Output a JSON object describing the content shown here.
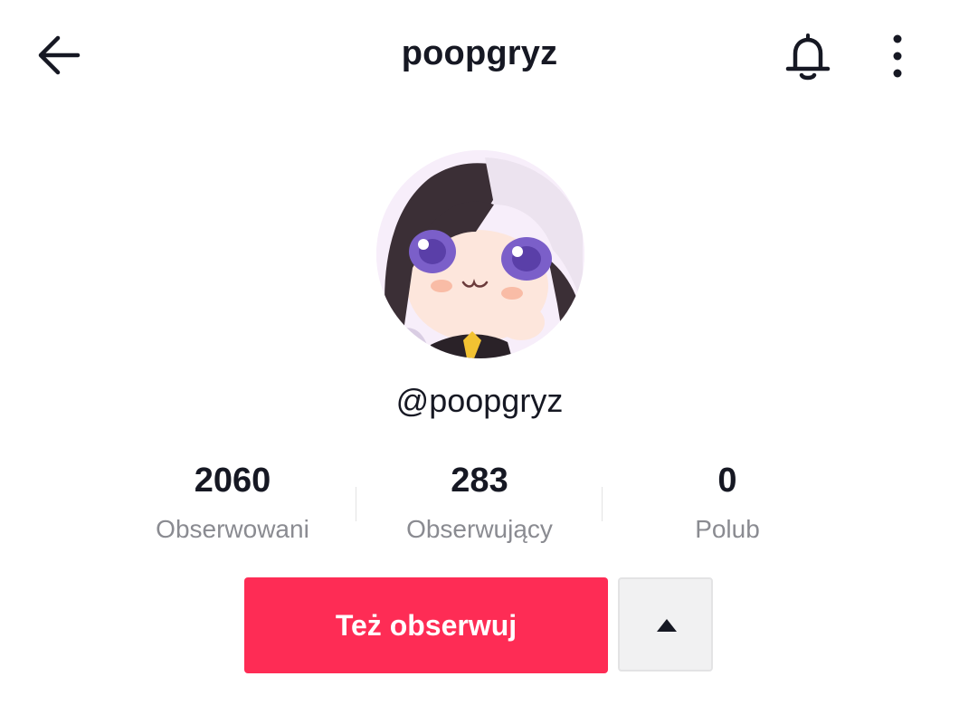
{
  "header": {
    "title": "poopgryz",
    "back_icon": "arrow-left-icon",
    "bell_icon": "bell-icon",
    "more_icon": "more-vertical-icon"
  },
  "profile": {
    "handle": "@poopgryz"
  },
  "stats": [
    {
      "value": "2060",
      "label": "Obserwowani"
    },
    {
      "value": "283",
      "label": "Obserwujący"
    },
    {
      "value": "0",
      "label": "Polub"
    }
  ],
  "actions": {
    "follow_label": "Też obserwuj",
    "expand_icon": "triangle-up-icon"
  },
  "colors": {
    "accent": "#fe2c55",
    "text": "#161823",
    "muted": "#8a8b91"
  }
}
